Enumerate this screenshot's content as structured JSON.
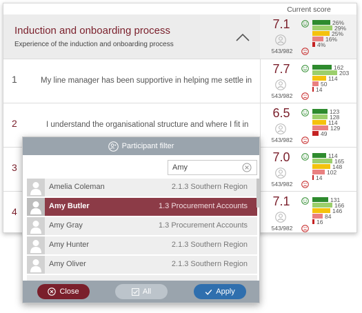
{
  "header": {
    "current_score_label": "Current score"
  },
  "section": {
    "title": "Induction and onboarding process",
    "subtitle": "Experience of the induction and onboarding process",
    "score": "7.1",
    "responses": "543/982",
    "bars": [
      {
        "label": "26%",
        "value": 26,
        "color": "#2e8b2e"
      },
      {
        "label": "29%",
        "value": 29,
        "color": "#9ccf6c"
      },
      {
        "label": "25%",
        "value": 25,
        "color": "#f4c20d"
      },
      {
        "label": "16%",
        "value": 16,
        "color": "#e98080"
      },
      {
        "label": "4%",
        "value": 4,
        "color": "#c42222"
      }
    ]
  },
  "rows": [
    {
      "number": "1",
      "text": "My line manager has been supportive in helping me settle in",
      "score": "7.7",
      "responses": "543/982",
      "bars": [
        {
          "label": "162",
          "value": 162
        },
        {
          "label": "203",
          "value": 203
        },
        {
          "label": "114",
          "value": 114
        },
        {
          "label": "50",
          "value": 50
        },
        {
          "label": "14",
          "value": 14
        }
      ]
    },
    {
      "number": "2",
      "text": "I understand the organisational structure and where I fit in",
      "score": "6.5",
      "responses": "543/982",
      "bars": [
        {
          "label": "123",
          "value": 123
        },
        {
          "label": "128",
          "value": 128
        },
        {
          "label": "114",
          "value": 114
        },
        {
          "label": "129",
          "value": 129
        },
        {
          "label": "49",
          "value": 49
        }
      ]
    },
    {
      "number": "3",
      "text": "",
      "score": "7.0",
      "responses": "543/982",
      "bars": [
        {
          "label": "114",
          "value": 114
        },
        {
          "label": "165",
          "value": 165
        },
        {
          "label": "148",
          "value": 148
        },
        {
          "label": "102",
          "value": 102
        },
        {
          "label": "14",
          "value": 14
        }
      ]
    },
    {
      "number": "4",
      "text": "",
      "score": "7.1",
      "responses": "543/982",
      "bars": [
        {
          "label": "131",
          "value": 131
        },
        {
          "label": "166",
          "value": 166
        },
        {
          "label": "146",
          "value": 146
        },
        {
          "label": "84",
          "value": 84
        },
        {
          "label": "16",
          "value": 16
        }
      ]
    }
  ],
  "bar_colors": [
    "#2e8b2e",
    "#9ccf6c",
    "#f4c20d",
    "#e98080",
    "#c42222"
  ],
  "filter": {
    "title": "Participant filter",
    "search_value": "Amy",
    "participants": [
      {
        "name": "Amelia Coleman",
        "group": "2.1.3 Southern Region",
        "selected": false
      },
      {
        "name": "Amy Butler",
        "group": "1.3 Procurement Accounts",
        "selected": true
      },
      {
        "name": "Amy Gray",
        "group": "1.3 Procurement Accounts",
        "selected": false
      },
      {
        "name": "Amy Hunter",
        "group": "2.1.3 Southern Region",
        "selected": false
      },
      {
        "name": "Amy Oliver",
        "group": "2.1.3 Southern Region",
        "selected": false
      }
    ],
    "buttons": {
      "close": "Close",
      "all": "All",
      "apply": "Apply"
    },
    "colors": {
      "header": "#9aa4ad",
      "selected": "#8c3b47",
      "close": "#7a1f2b",
      "apply": "#2f6fae"
    }
  }
}
